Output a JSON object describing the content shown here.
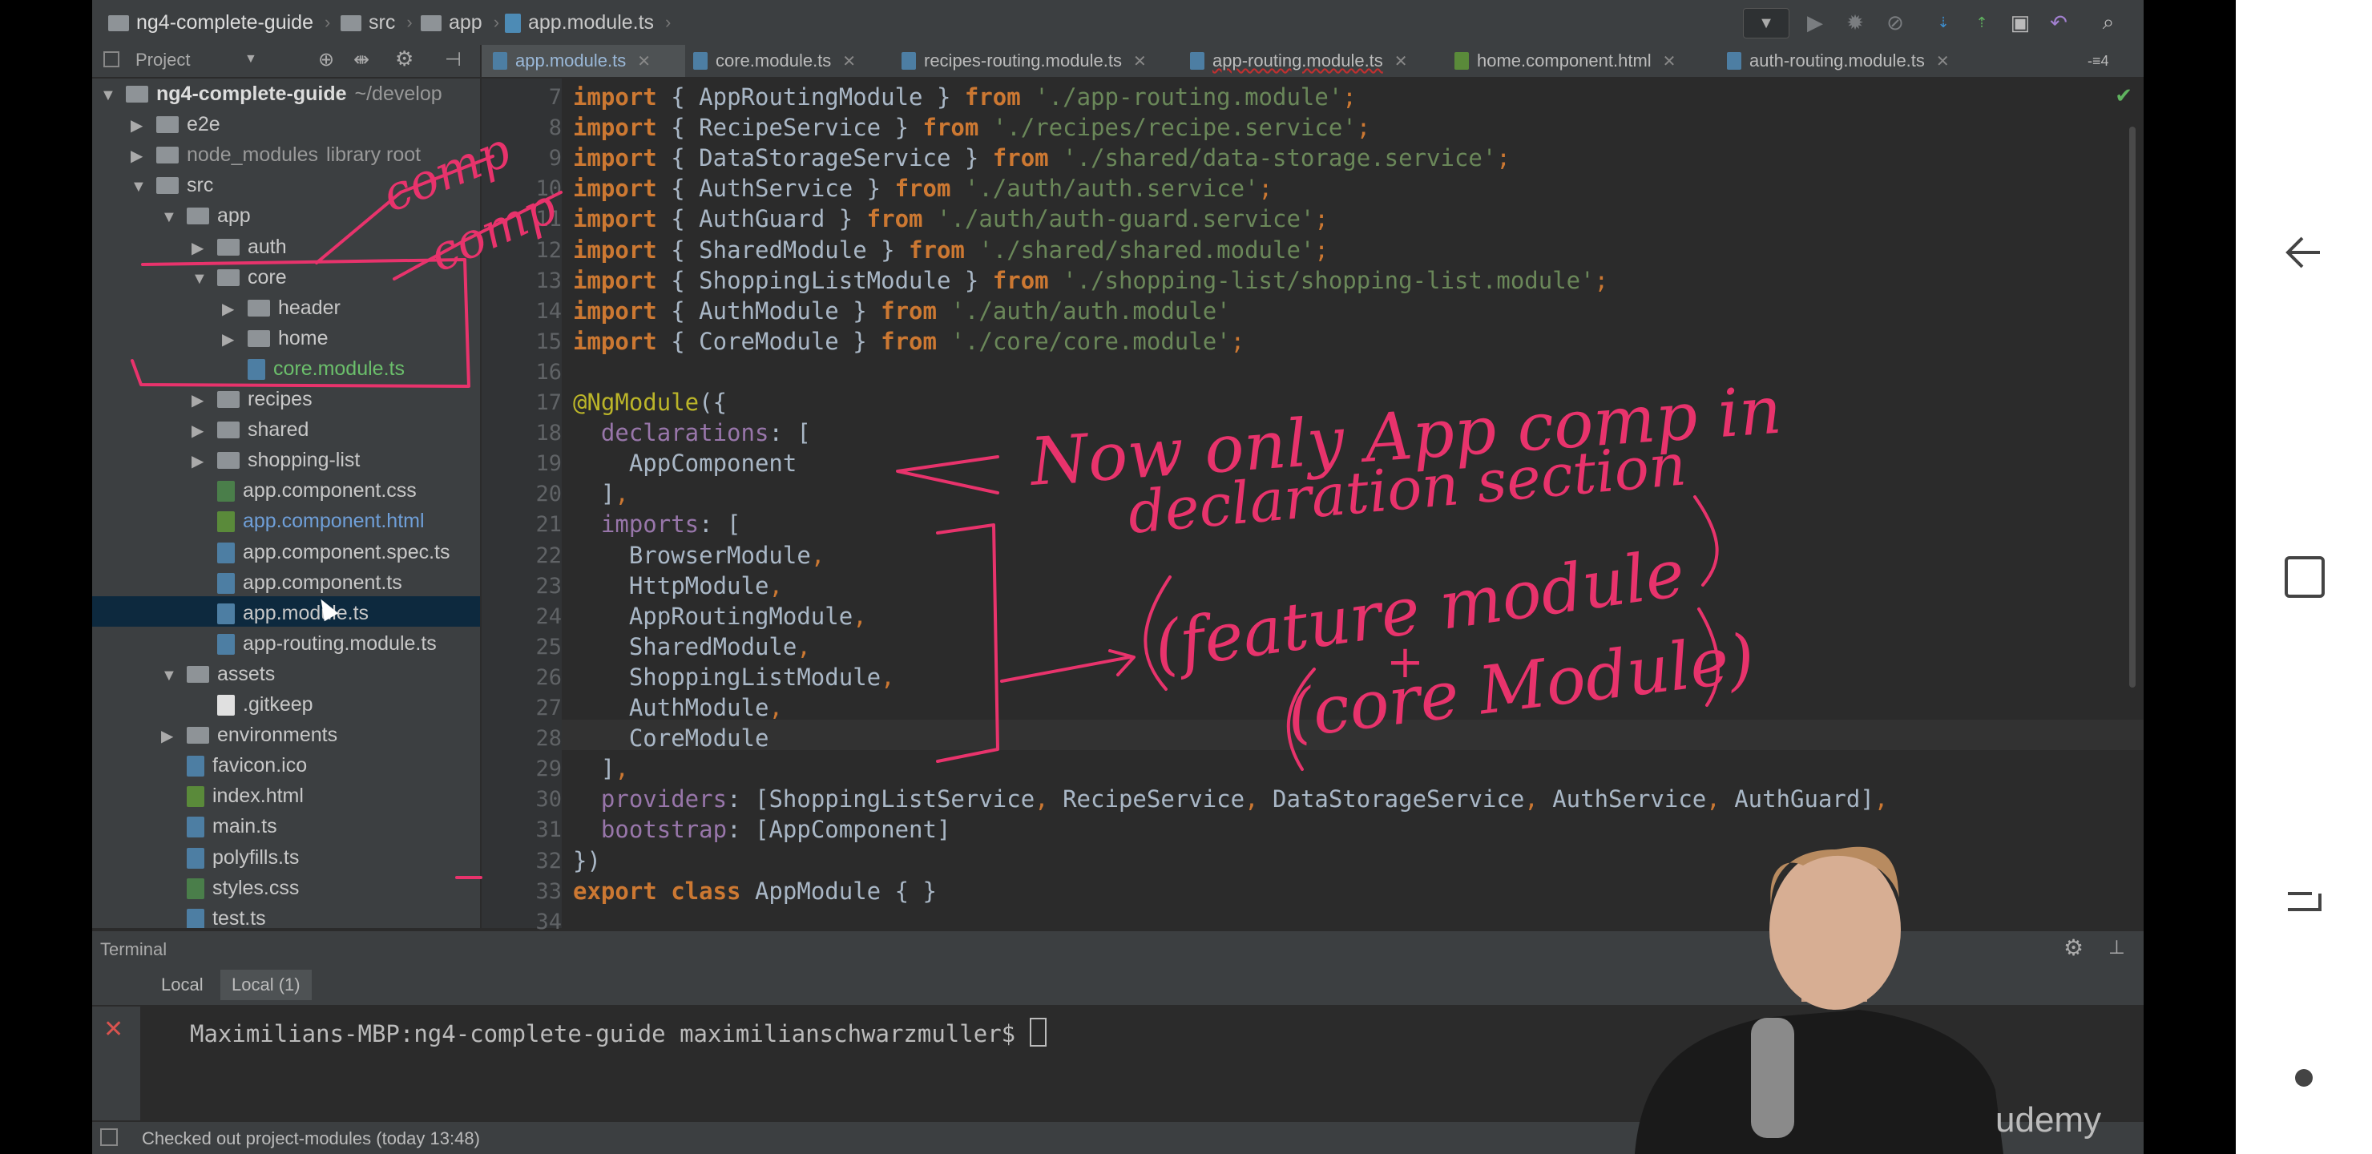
{
  "navbar": {
    "breadcrumbs": [
      "ng4-complete-guide",
      "src",
      "app",
      "app.module.ts"
    ]
  },
  "project_panel": {
    "title": "Project",
    "tree": [
      {
        "label": "ng4-complete-guide",
        "extra": "~/develop",
        "type": "folder",
        "expanded": true,
        "depth": 0
      },
      {
        "label": "e2e",
        "type": "folder",
        "expanded": false,
        "depth": 1
      },
      {
        "label": "node_modules",
        "extra": "library root",
        "type": "folder",
        "expanded": false,
        "depth": 1
      },
      {
        "label": "src",
        "type": "folder",
        "expanded": true,
        "depth": 1
      },
      {
        "label": "app",
        "type": "folder",
        "expanded": true,
        "depth": 2
      },
      {
        "label": "auth",
        "type": "folder",
        "expanded": false,
        "depth": 3
      },
      {
        "label": "core",
        "type": "folder",
        "expanded": true,
        "depth": 3
      },
      {
        "label": "header",
        "type": "folder",
        "expanded": false,
        "depth": 4
      },
      {
        "label": "home",
        "type": "folder",
        "expanded": false,
        "depth": 4
      },
      {
        "label": "core.module.ts",
        "type": "ts",
        "depth": 4
      },
      {
        "label": "recipes",
        "type": "folder",
        "expanded": false,
        "depth": 3
      },
      {
        "label": "shared",
        "type": "folder",
        "expanded": false,
        "depth": 3
      },
      {
        "label": "shopping-list",
        "type": "folder",
        "expanded": false,
        "depth": 3
      },
      {
        "label": "app.component.css",
        "type": "css",
        "depth": 3
      },
      {
        "label": "app.component.html",
        "type": "html",
        "depth": 3
      },
      {
        "label": "app.component.spec.ts",
        "type": "ts",
        "depth": 3
      },
      {
        "label": "app.component.ts",
        "type": "ts",
        "depth": 3
      },
      {
        "label": "app.module.ts",
        "type": "ts",
        "depth": 3,
        "selected": true
      },
      {
        "label": "app-routing.module.ts",
        "type": "ts",
        "depth": 3
      },
      {
        "label": "assets",
        "type": "folder",
        "expanded": true,
        "depth": 2
      },
      {
        "label": ".gitkeep",
        "type": "plain",
        "depth": 3
      },
      {
        "label": "environments",
        "type": "folder",
        "expanded": false,
        "depth": 2
      },
      {
        "label": "favicon.ico",
        "type": "ts",
        "depth": 2
      },
      {
        "label": "index.html",
        "type": "html",
        "depth": 2
      },
      {
        "label": "main.ts",
        "type": "ts",
        "depth": 2
      },
      {
        "label": "polyfills.ts",
        "type": "ts",
        "depth": 2
      },
      {
        "label": "styles.css",
        "type": "css",
        "depth": 2
      },
      {
        "label": "test.ts",
        "type": "ts",
        "depth": 2
      }
    ]
  },
  "tabs": [
    {
      "label": "app.module.ts",
      "active": true
    },
    {
      "label": "core.module.ts"
    },
    {
      "label": "recipes-routing.module.ts"
    },
    {
      "label": "app-routing.module.ts"
    },
    {
      "label": "home.component.html"
    },
    {
      "label": "auth-routing.module.ts"
    }
  ],
  "tabs_overflow": "4",
  "editor": {
    "first_line_number": 7,
    "last_line_number": 34,
    "lines": [
      [
        [
          "kw",
          "import"
        ],
        [
          "p",
          " { AppRoutingModule } "
        ],
        [
          "kw",
          "from"
        ],
        [
          "p",
          " "
        ],
        [
          "str",
          "'./app-routing.module'"
        ],
        [
          "pun",
          ";"
        ]
      ],
      [
        [
          "kw",
          "import"
        ],
        [
          "p",
          " { RecipeService } "
        ],
        [
          "kw",
          "from"
        ],
        [
          "p",
          " "
        ],
        [
          "str",
          "'./recipes/recipe.service'"
        ],
        [
          "pun",
          ";"
        ]
      ],
      [
        [
          "kw",
          "import"
        ],
        [
          "p",
          " { DataStorageService } "
        ],
        [
          "kw",
          "from"
        ],
        [
          "p",
          " "
        ],
        [
          "str",
          "'./shared/data-storage.service'"
        ],
        [
          "pun",
          ";"
        ]
      ],
      [
        [
          "kw",
          "import"
        ],
        [
          "p",
          " { AuthService } "
        ],
        [
          "kw",
          "from"
        ],
        [
          "p",
          " "
        ],
        [
          "str",
          "'./auth/auth.service'"
        ],
        [
          "pun",
          ";"
        ]
      ],
      [
        [
          "kw",
          "import"
        ],
        [
          "p",
          " { AuthGuard } "
        ],
        [
          "kw",
          "from"
        ],
        [
          "p",
          " "
        ],
        [
          "str",
          "'./auth/auth-guard.service'"
        ],
        [
          "pun",
          ";"
        ]
      ],
      [
        [
          "kw",
          "import"
        ],
        [
          "p",
          " { SharedModule } "
        ],
        [
          "kw",
          "from"
        ],
        [
          "p",
          " "
        ],
        [
          "str",
          "'./shared/shared.module'"
        ],
        [
          "pun",
          ";"
        ]
      ],
      [
        [
          "kw",
          "import"
        ],
        [
          "p",
          " { ShoppingListModule } "
        ],
        [
          "kw",
          "from"
        ],
        [
          "p",
          " "
        ],
        [
          "str",
          "'./shopping-list/shopping-list.module'"
        ],
        [
          "pun",
          ";"
        ]
      ],
      [
        [
          "kw",
          "import"
        ],
        [
          "p",
          " { AuthModule } "
        ],
        [
          "kw",
          "from"
        ],
        [
          "p",
          " "
        ],
        [
          "str",
          "'./auth/auth.module'"
        ]
      ],
      [
        [
          "kw",
          "import"
        ],
        [
          "p",
          " { CoreModule } "
        ],
        [
          "kw",
          "from"
        ],
        [
          "p",
          " "
        ],
        [
          "str",
          "'./core/core.module'"
        ],
        [
          "pun",
          ";"
        ]
      ],
      [],
      [
        [
          "ann",
          "@NgModule"
        ],
        [
          "p",
          "({"
        ]
      ],
      [
        [
          "p",
          "  "
        ],
        [
          "fld",
          "declarations"
        ],
        [
          "p",
          ": ["
        ]
      ],
      [
        [
          "p",
          "    AppComponent"
        ]
      ],
      [
        [
          "p",
          "  ]"
        ],
        [
          "pun",
          ","
        ]
      ],
      [
        [
          "p",
          "  "
        ],
        [
          "fld",
          "imports"
        ],
        [
          "p",
          ": ["
        ]
      ],
      [
        [
          "p",
          "    BrowserModule"
        ],
        [
          "pun",
          ","
        ]
      ],
      [
        [
          "p",
          "    HttpModule"
        ],
        [
          "pun",
          ","
        ]
      ],
      [
        [
          "p",
          "    AppRoutingModule"
        ],
        [
          "pun",
          ","
        ]
      ],
      [
        [
          "p",
          "    SharedModule"
        ],
        [
          "pun",
          ","
        ]
      ],
      [
        [
          "p",
          "    ShoppingListModule"
        ],
        [
          "pun",
          ","
        ]
      ],
      [
        [
          "p",
          "    AuthModule"
        ],
        [
          "pun",
          ","
        ]
      ],
      [
        [
          "p",
          "    CoreModule"
        ]
      ],
      [
        [
          "p",
          "  ]"
        ],
        [
          "pun",
          ","
        ]
      ],
      [
        [
          "p",
          "  "
        ],
        [
          "fld",
          "providers"
        ],
        [
          "p",
          ": [ShoppingListService"
        ],
        [
          "pun",
          ","
        ],
        [
          "p",
          " RecipeService"
        ],
        [
          "pun",
          ","
        ],
        [
          "p",
          " DataStorageService"
        ],
        [
          "pun",
          ","
        ],
        [
          "p",
          " AuthService"
        ],
        [
          "pun",
          ","
        ],
        [
          "p",
          " AuthGuard]"
        ],
        [
          "pun",
          ","
        ]
      ],
      [
        [
          "p",
          "  "
        ],
        [
          "fld",
          "bootstrap"
        ],
        [
          "p",
          ": [AppComponent]"
        ]
      ],
      [
        [
          "p",
          "})"
        ]
      ],
      [
        [
          "kw",
          "export class"
        ],
        [
          "p",
          " AppModule { }"
        ]
      ],
      []
    ]
  },
  "terminal": {
    "title": "Terminal",
    "tabs": [
      "Local",
      "Local (1)"
    ],
    "prompt": "Maximilians-MBP:ng4-complete-guide maximilianschwarzmuller$ "
  },
  "status": {
    "message": "Checked out project-modules (today 13:48)"
  },
  "watermark": "udemy",
  "annotations": {
    "note_1": "comp",
    "note_2": "comp",
    "note_3_line1": "Now only App comp in",
    "note_3_line2": "declaration section",
    "note_4_line1": "(feature module",
    "note_4_line2": "+",
    "note_4_line3": "(core Module)"
  },
  "colors": {
    "ink": "#e8336c",
    "ide_bg": "#2b2b2b",
    "panel_bg": "#3c3f41",
    "keyword": "#cc7832",
    "string": "#6a8759",
    "field": "#9876aa",
    "annotation": "#bbb529"
  },
  "icons": [
    "folder-icon",
    "file-icon",
    "run-icon",
    "debug-icon",
    "vcs-update-icon",
    "vcs-commit-icon",
    "undo-icon",
    "search-icon",
    "gear-icon",
    "plus-icon",
    "close-icon",
    "back-icon",
    "home-icon",
    "recents-icon",
    "dot-icon"
  ]
}
